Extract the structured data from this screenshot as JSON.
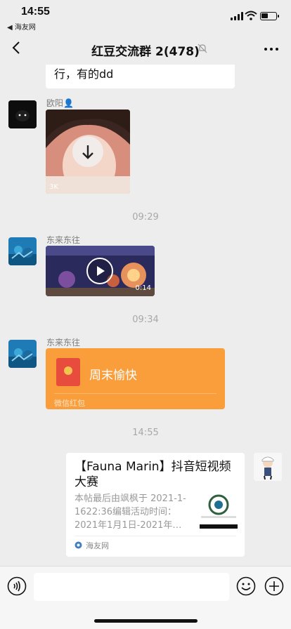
{
  "status_bar": {
    "time": "14:55",
    "back_app": "◀ 海友网",
    "battery_level": 0.45
  },
  "navbar": {
    "title": "红豆交流群 2(478)"
  },
  "messages": {
    "top_text": "行，有的dd",
    "msg1": {
      "sender": "欧阳👤",
      "image_size": "3K"
    },
    "ts1": "09:29",
    "msg2": {
      "sender": "东来东往",
      "video_duration": "0:14"
    },
    "ts2": "09:34",
    "msg3": {
      "sender": "东来东往",
      "redpacket_title": "周末愉快",
      "redpacket_label": "微信红包"
    },
    "ts3": "14:55",
    "msg4": {
      "link_title": "【Fauna Marin】抖音短视频大赛",
      "link_desc": "本帖最后由飒枫于 2021-1-1622:36编辑活动时间：2021年1月1日-2021年…",
      "link_source": "海友网"
    }
  },
  "colors": {
    "redpacket": "#fa9d3b",
    "background": "#ededed"
  }
}
